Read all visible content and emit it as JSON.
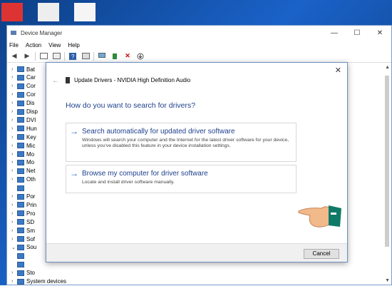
{
  "window": {
    "title": "Device Manager",
    "controls": {
      "minimize": "—",
      "maximize": "☐",
      "close": "✕"
    }
  },
  "menu": [
    "File",
    "Action",
    "View",
    "Help"
  ],
  "tree": [
    {
      "label": "Bat",
      "chev": "›"
    },
    {
      "label": "Car",
      "chev": "›"
    },
    {
      "label": "Cor",
      "chev": "›"
    },
    {
      "label": "Cor",
      "chev": "›"
    },
    {
      "label": "Dis",
      "chev": "›"
    },
    {
      "label": "Disp",
      "chev": "›"
    },
    {
      "label": "DVI",
      "chev": "›"
    },
    {
      "label": "Hun",
      "chev": "›"
    },
    {
      "label": "Key",
      "chev": "›"
    },
    {
      "label": "Mic",
      "chev": "›"
    },
    {
      "label": "Mo",
      "chev": "›"
    },
    {
      "label": "Mo",
      "chev": "›"
    },
    {
      "label": "Net",
      "chev": "›"
    },
    {
      "label": "Oth",
      "chev": "›"
    },
    {
      "label": "",
      "chev": ""
    },
    {
      "label": "Por",
      "chev": "›"
    },
    {
      "label": "Prin",
      "chev": "›"
    },
    {
      "label": "Pro",
      "chev": "›"
    },
    {
      "label": "SD",
      "chev": "›"
    },
    {
      "label": "Sm",
      "chev": "›"
    },
    {
      "label": "Sof",
      "chev": "›"
    },
    {
      "label": "Sou",
      "chev": "⌄"
    },
    {
      "label": "",
      "chev": ""
    },
    {
      "label": "",
      "chev": ""
    },
    {
      "label": "Sto",
      "chev": "›"
    },
    {
      "label": "System devices",
      "chev": "›"
    }
  ],
  "dialog": {
    "title": "Update Drivers - NVIDIA High Definition Audio",
    "heading": "How do you want to search for drivers?",
    "option_auto": {
      "title": "Search automatically for updated driver software",
      "desc": "Windows will search your computer and the Internet for the latest driver software for your device, unless you've disabled this feature in your device installation settings."
    },
    "option_browse": {
      "title": "Browse my computer for driver software",
      "desc": "Locate and install driver software manually."
    },
    "cancel": "Cancel",
    "close_glyph": "✕",
    "back_glyph": "←",
    "arrow_glyph": "→"
  },
  "colors": {
    "link": "#1e3f8c",
    "accent": "#1a5fb4",
    "hand_cuff": "#0f7a67"
  }
}
